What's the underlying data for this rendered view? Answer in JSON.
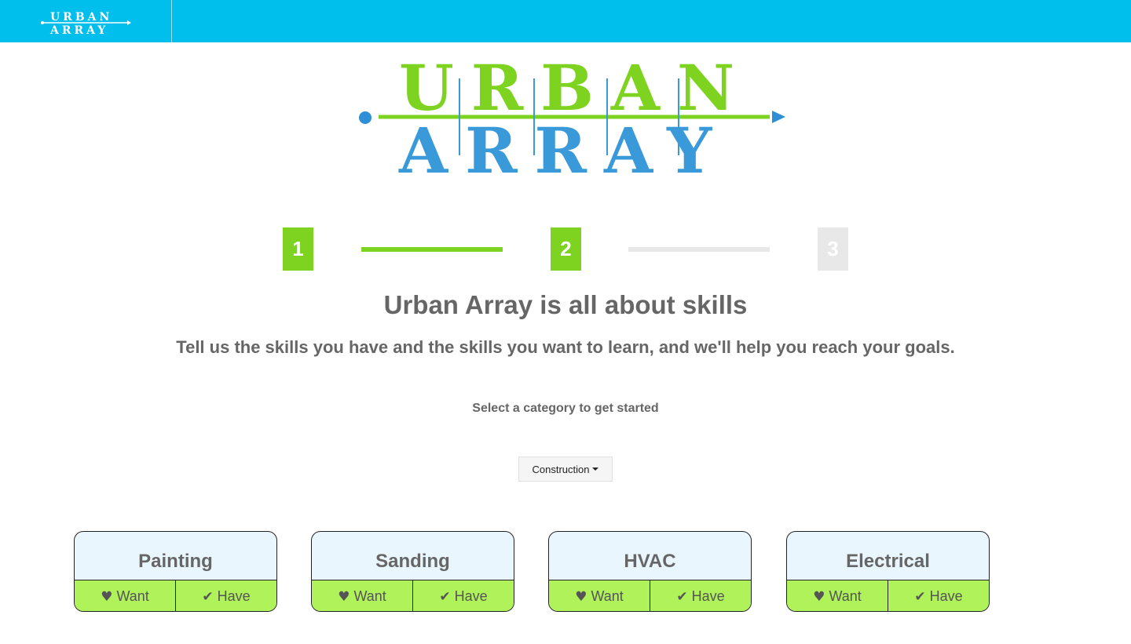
{
  "nav": {
    "logo_top": "URBAN",
    "logo_bottom": "ARRAY"
  },
  "hero": {
    "logo_top": "URBAN",
    "logo_bottom": "ARRAY",
    "colors": {
      "top": "#7ed321",
      "bottom": "#3a9ad9",
      "line": "#7ed321",
      "marker": "#2e8fd6"
    }
  },
  "steps": {
    "items": [
      "1",
      "2",
      "3"
    ],
    "active_color": "#7ed321",
    "inactive_color": "#e8e8e8"
  },
  "page": {
    "title": "Urban Array is all about skills",
    "subtitle": "Tell us the skills you have and the skills you want to learn, and we'll help you reach your goals.",
    "prompt": "Select a category to get started"
  },
  "category_dropdown": {
    "selected": "Construction"
  },
  "skills": [
    {
      "name": "Painting",
      "want": "Want",
      "have": "Have",
      "want_icon": "heart-icon",
      "have_icon": "check-icon"
    },
    {
      "name": "Sanding",
      "want": "Want",
      "have": "Have",
      "want_icon": "heart-icon",
      "have_icon": "check-icon"
    },
    {
      "name": "HVAC",
      "want": "Want",
      "have": "Have",
      "want_icon": "heart-icon",
      "have_icon": "check-icon"
    },
    {
      "name": "Electrical",
      "want": "Want",
      "have": "Have",
      "want_icon": "heart-icon",
      "have_icon": "check-icon"
    }
  ]
}
